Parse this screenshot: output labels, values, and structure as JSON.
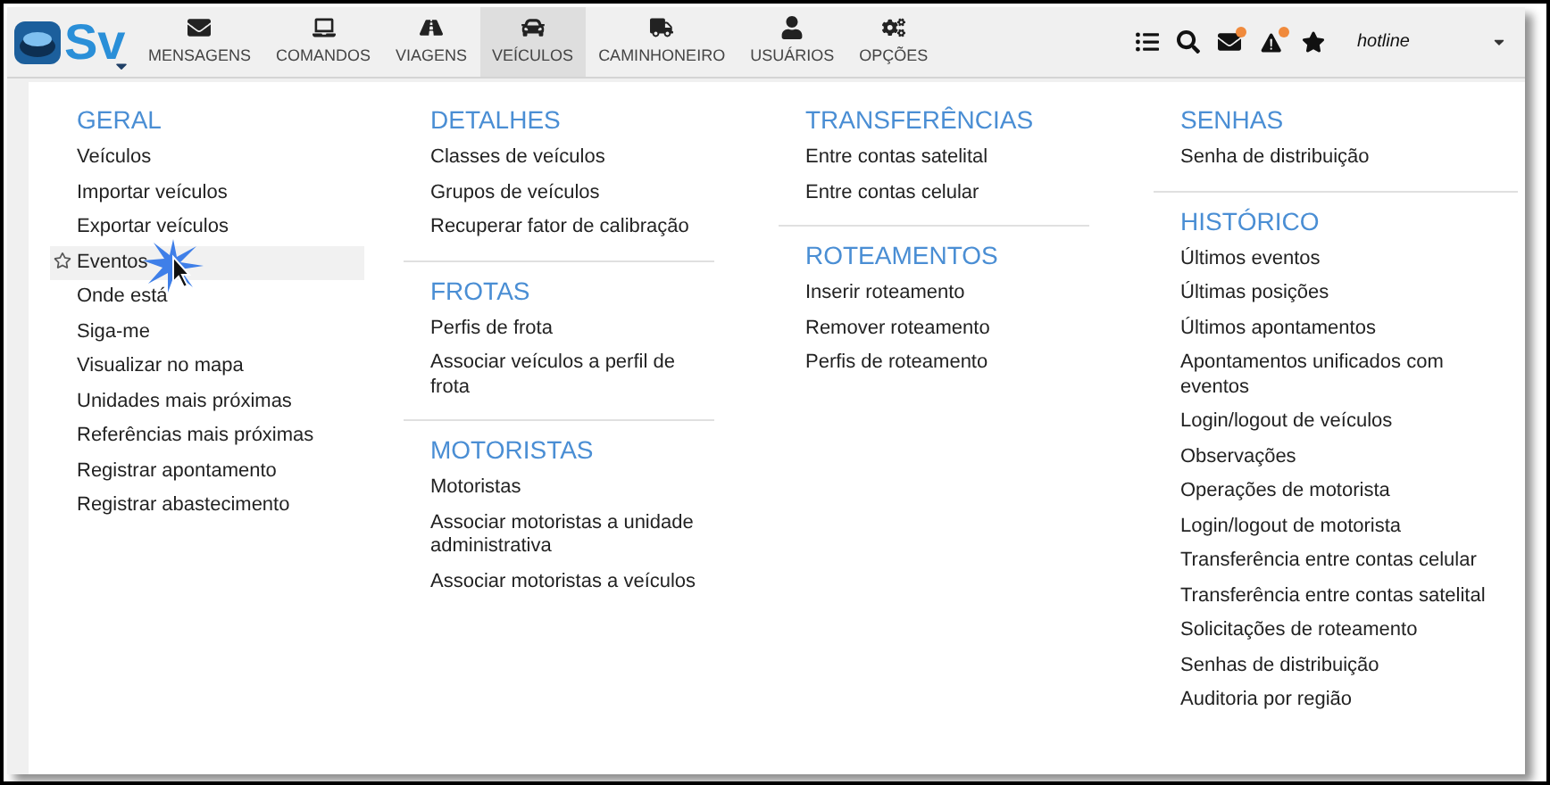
{
  "logo": {
    "text": "Sv"
  },
  "nav": [
    {
      "label": "MENSAGENS",
      "selected": false
    },
    {
      "label": "COMANDOS",
      "selected": false
    },
    {
      "label": "VIAGENS",
      "selected": false
    },
    {
      "label": "VEÍCULOS",
      "selected": true
    },
    {
      "label": "CAMINHONEIRO",
      "selected": false
    },
    {
      "label": "USUÁRIOS",
      "selected": false
    },
    {
      "label": "OPÇÕES",
      "selected": false
    }
  ],
  "toolbar": {
    "messages_alert": true,
    "warnings_alert": true,
    "user": "hotline"
  },
  "menu_columns": [
    [
      {
        "title": "GERAL",
        "items": [
          {
            "label": "Veículos",
            "highlighted": false
          },
          {
            "label": "Importar veículos",
            "highlighted": false
          },
          {
            "label": "Exportar veículos",
            "highlighted": false
          },
          {
            "label": "Eventos",
            "highlighted": true
          },
          {
            "label": "Onde está",
            "highlighted": false
          },
          {
            "label": "Siga-me",
            "highlighted": false
          },
          {
            "label": "Visualizar no mapa",
            "highlighted": false
          },
          {
            "label": "Unidades mais próximas",
            "highlighted": false
          },
          {
            "label": "Referências mais próximas",
            "highlighted": false
          },
          {
            "label": "Registrar apontamento",
            "highlighted": false
          },
          {
            "label": "Registrar abastecimento",
            "highlighted": false
          }
        ]
      }
    ],
    [
      {
        "title": "DETALHES",
        "items": [
          {
            "label": "Classes de veículos",
            "highlighted": false
          },
          {
            "label": "Grupos de veículos",
            "highlighted": false
          },
          {
            "label": "Recuperar fator de calibração",
            "highlighted": false
          }
        ]
      },
      {
        "title": "FROTAS",
        "items": [
          {
            "label": "Perfis de frota",
            "highlighted": false
          },
          {
            "label": "Associar veículos a perfil de frota",
            "highlighted": false
          }
        ]
      },
      {
        "title": "MOTORISTAS",
        "items": [
          {
            "label": "Motoristas",
            "highlighted": false
          },
          {
            "label": "Associar motoristas a unidade administrativa",
            "highlighted": false
          },
          {
            "label": "Associar motoristas a veículos",
            "highlighted": false
          }
        ]
      }
    ],
    [
      {
        "title": "TRANSFERÊNCIAS",
        "items": [
          {
            "label": "Entre contas satelital",
            "highlighted": false
          },
          {
            "label": "Entre contas celular",
            "highlighted": false
          }
        ]
      },
      {
        "title": "ROTEAMENTOS",
        "items": [
          {
            "label": "Inserir roteamento",
            "highlighted": false
          },
          {
            "label": "Remover roteamento",
            "highlighted": false
          },
          {
            "label": "Perfis de roteamento",
            "highlighted": false
          }
        ]
      }
    ],
    [
      {
        "title": "SENHAS",
        "items": [
          {
            "label": "Senha de distribuição",
            "highlighted": false
          }
        ]
      },
      {
        "title": "HISTÓRICO",
        "items": [
          {
            "label": "Últimos eventos",
            "highlighted": false
          },
          {
            "label": "Últimas posições",
            "highlighted": false
          },
          {
            "label": "Últimos apontamentos",
            "highlighted": false
          },
          {
            "label": "Apontamentos unificados com eventos",
            "highlighted": false
          },
          {
            "label": "Login/logout de veículos",
            "highlighted": false
          },
          {
            "label": "Observações",
            "highlighted": false
          },
          {
            "label": "Operações de motorista",
            "highlighted": false
          },
          {
            "label": "Login/logout de motorista",
            "highlighted": false
          },
          {
            "label": "Transferência entre contas celular",
            "highlighted": false
          },
          {
            "label": "Transferência entre contas satelital",
            "highlighted": false
          },
          {
            "label": "Solicitações de roteamento",
            "highlighted": false
          },
          {
            "label": "Senhas de distribuição",
            "highlighted": false
          },
          {
            "label": "Auditoria por região",
            "highlighted": false
          }
        ]
      }
    ]
  ]
}
